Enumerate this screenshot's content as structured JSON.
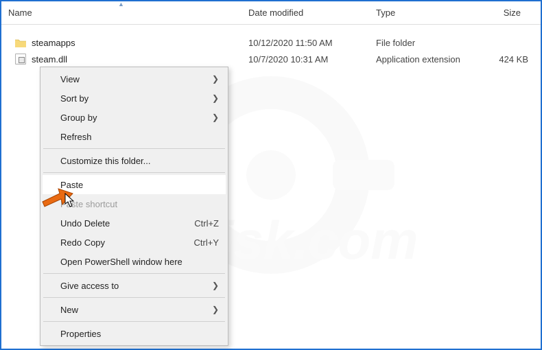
{
  "columns": {
    "name": "Name",
    "date": "Date modified",
    "type": "Type",
    "size": "Size"
  },
  "files": [
    {
      "name": "steamapps",
      "date": "10/12/2020 11:50 AM",
      "type": "File folder",
      "size": "",
      "icon": "folder"
    },
    {
      "name": "steam.dll",
      "date": "10/7/2020 10:31 AM",
      "type": "Application extension",
      "size": "424 KB",
      "icon": "dll"
    }
  ],
  "context_menu": {
    "view": "View",
    "sort_by": "Sort by",
    "group_by": "Group by",
    "refresh": "Refresh",
    "customize": "Customize this folder...",
    "paste": "Paste",
    "paste_shortcut": "Paste shortcut",
    "undo_delete": "Undo Delete",
    "undo_delete_key": "Ctrl+Z",
    "redo_copy": "Redo Copy",
    "redo_copy_key": "Ctrl+Y",
    "open_powershell": "Open PowerShell window here",
    "give_access": "Give access to",
    "new": "New",
    "properties": "Properties"
  },
  "watermark_text": "PCrisk.com"
}
